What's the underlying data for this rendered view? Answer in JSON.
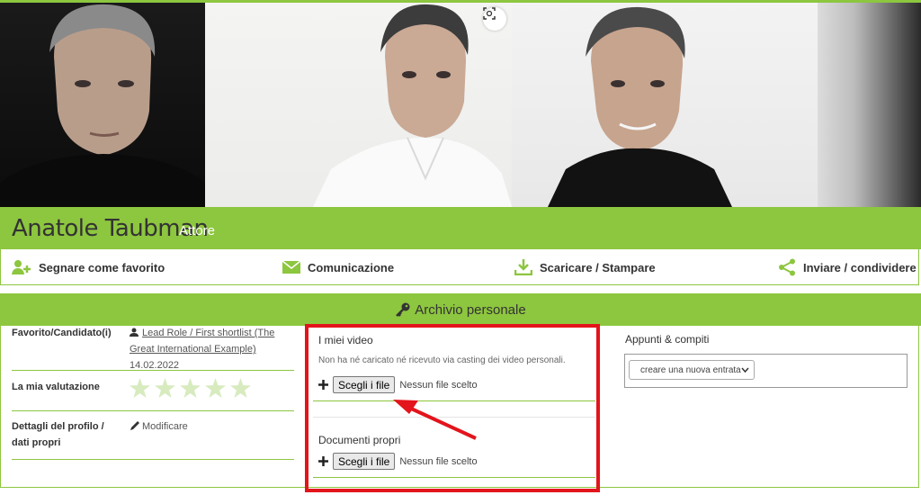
{
  "profile": {
    "name": "Anatole Taubman",
    "role": "Attore"
  },
  "actions": {
    "favorite": "Segnare come favorito",
    "communication": "Comunicazione",
    "download": "Scaricare / Stampare",
    "share": "Inviare / condividere"
  },
  "archive": {
    "title": "Archivio personale"
  },
  "details": {
    "favorite_label": "Favorito/Candidato(i)",
    "favorite_link": "Lead Role / First shortlist (The Great International Example)",
    "favorite_date": "14.02.2022",
    "rating_label": "La mia valutazione",
    "rating": 0,
    "rating_max": 5,
    "profile_label": "Dettagli del profilo / dati propri",
    "profile_edit": "Modificare"
  },
  "videos": {
    "title": "I miei video",
    "description": "Non ha né caricato né ricevuto via casting dei video personali.",
    "choose_label": "Scegli i file",
    "no_file": "Nessun file scelto"
  },
  "documents": {
    "title": "Documenti propri",
    "choose_label": "Scegli i file",
    "no_file": "Nessun file scelto"
  },
  "notes": {
    "title": "Appunti & compiti",
    "select_value": "creare una nuova entrata"
  },
  "colors": {
    "accent": "#8dc63f",
    "highlight": "#e3141b"
  }
}
